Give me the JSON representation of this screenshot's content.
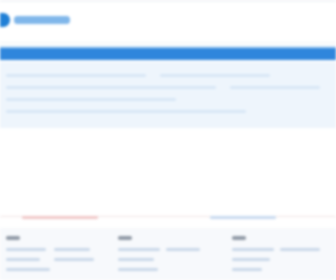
{
  "header": {
    "logo_icon": "brand-logo-icon",
    "logo_text": ""
  },
  "nav": {
    "color": "#2f86dc"
  },
  "content": {
    "background": "#eef5fc"
  },
  "footer": {
    "columns": [
      "",
      "",
      ""
    ]
  }
}
